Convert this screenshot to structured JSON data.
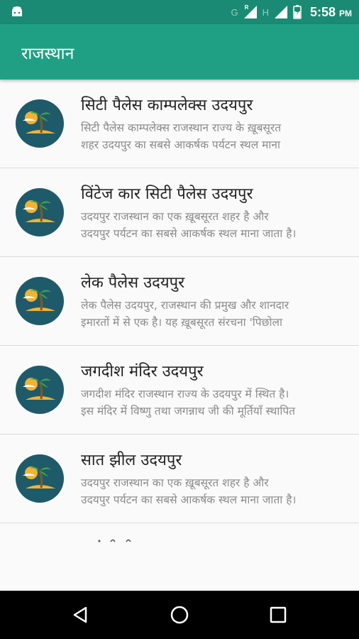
{
  "status_bar": {
    "time": "5:58",
    "ampm": "PM",
    "network_g": "G",
    "network_r": "R",
    "network_h": "H"
  },
  "app_bar": {
    "title": "राजस्थान"
  },
  "list_items": [
    {
      "title": "सिटी पैलेस काम्पलेक्स उदयपुर",
      "desc_line1": "सिटी पैलेस काम्पलेक्स राजस्थान राज्य के ख़ूबसूरत",
      "desc_line2": "शहर उदयपुर का सबसे आकर्षक पर्यटन स्थल माना",
      "icon": "island-palm-icon"
    },
    {
      "title": "विंटेज कार सिटी पैलेस उदयपुर",
      "desc_line1": "उदयपुर राजस्थान का एक ख़ूबसूरत शहर है और",
      "desc_line2": "उदयपुर पर्यटन का सबसे आकर्षक स्थल माना जाता है।",
      "icon": "island-palm-icon"
    },
    {
      "title": "लेक पैलेस उदयपुर",
      "desc_line1": "लेक पैलेस उदयपुर, राजस्थान की प्रमुख और शानदार",
      "desc_line2": "इमारतों में से एक है। यह ख़ूबसूरत संरचना 'पिछोला",
      "icon": "island-palm-icon"
    },
    {
      "title": "जगदीश मंदिर उदयपुर",
      "desc_line1": "जगदीश मंदिर राजस्थान राज्य के उदयपुर में स्थित है।",
      "desc_line2": "इस मंदिर में विष्णु तथा जगन्नाथ जी की मूर्तियाँ स्थापित",
      "icon": "island-palm-icon"
    },
    {
      "title": "सात झील उदयपुर",
      "desc_line1": "उदयपुर राजस्थान का एक ख़ूबसूरत शहर है और",
      "desc_line2": "उदयपुर पर्यटन का सबसे आकर्षक स्थल माना जाता है।",
      "icon": "island-palm-icon"
    }
  ],
  "colors": {
    "status_bar": "#1b8a74",
    "app_bar": "#1fa085",
    "icon_bg": "#1f5a6a",
    "sand": "#f2b233",
    "palm": "#3ea34a"
  },
  "nav": {
    "back": "back-icon",
    "home": "home-icon",
    "recents": "recents-icon"
  }
}
